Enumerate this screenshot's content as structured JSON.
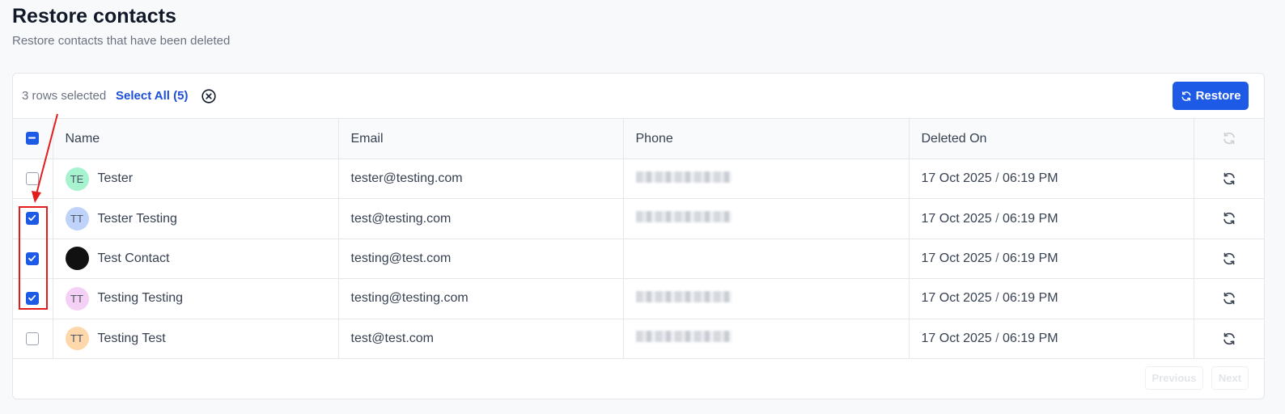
{
  "header": {
    "title": "Restore contacts",
    "subtitle": "Restore contacts that have been deleted"
  },
  "toolbar": {
    "selected_text": "3 rows selected",
    "select_all_label": "Select All (5)",
    "restore_label": "Restore"
  },
  "table": {
    "columns": [
      "Name",
      "Email",
      "Phone",
      "Deleted On"
    ],
    "rows": [
      {
        "checked": false,
        "initials": "TE",
        "avatar_color": "#a7f3d0",
        "name": "Tester",
        "email": "tester@testing.com",
        "date": "17 Oct 2025",
        "sep": "/",
        "time": "06:19 PM",
        "phone_blurred": true
      },
      {
        "checked": true,
        "initials": "TT",
        "avatar_color": "#bfd3fa",
        "name": "Tester Testing",
        "email": "test@testing.com",
        "date": "17 Oct 2025",
        "sep": "/",
        "time": "06:19 PM",
        "phone_blurred": true
      },
      {
        "checked": true,
        "initials": "",
        "avatar_color": "#111111",
        "name": "Test Contact",
        "email": "testing@test.com",
        "date": "17 Oct 2025",
        "sep": "/",
        "time": "06:19 PM",
        "phone_blurred": false
      },
      {
        "checked": true,
        "initials": "TT",
        "avatar_color": "#f5d0f5",
        "name": "Testing Testing",
        "email": "testing@testing.com",
        "date": "17 Oct 2025",
        "sep": "/",
        "time": "06:19 PM",
        "phone_blurred": true
      },
      {
        "checked": false,
        "initials": "TT",
        "avatar_color": "#fed7aa",
        "name": "Testing Test",
        "email": "test@test.com",
        "date": "17 Oct 2025",
        "sep": "/",
        "time": "06:19 PM",
        "phone_blurred": true
      }
    ]
  },
  "pagination": {
    "previous_label": "Previous",
    "next_label": "Next"
  },
  "colors": {
    "accent": "#1d5ae6",
    "link": "#1d4ed8",
    "annotation": "#e11d1d"
  }
}
